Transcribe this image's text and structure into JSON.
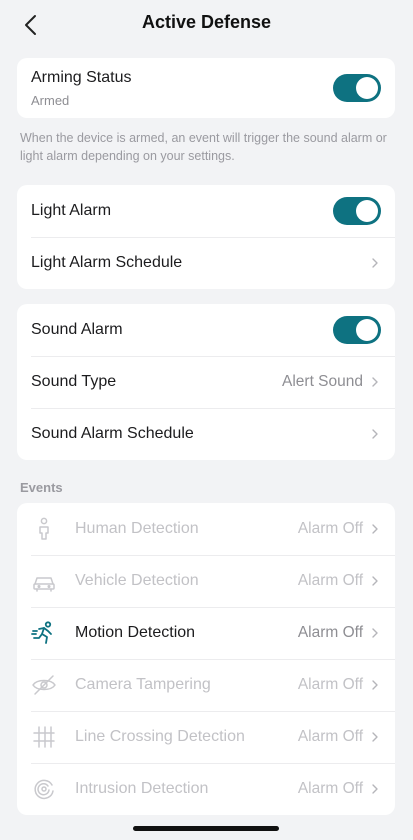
{
  "header": {
    "title": "Active Defense"
  },
  "arming": {
    "title": "Arming Status",
    "status": "Armed",
    "enabled": true,
    "note": "When the device is armed, an event will trigger the sound alarm or light alarm depending on your settings."
  },
  "light": {
    "label": "Light Alarm",
    "enabled": true,
    "schedule_label": "Light Alarm Schedule"
  },
  "sound": {
    "label": "Sound Alarm",
    "enabled": true,
    "type_label": "Sound Type",
    "type_value": "Alert Sound",
    "schedule_label": "Sound Alarm Schedule"
  },
  "events": {
    "section_label": "Events",
    "items": [
      {
        "icon": "human-icon",
        "label": "Human Detection",
        "value": "Alarm Off",
        "active": false
      },
      {
        "icon": "vehicle-icon",
        "label": "Vehicle Detection",
        "value": "Alarm Off",
        "active": false
      },
      {
        "icon": "running-person-icon",
        "label": "Motion Detection",
        "value": "Alarm Off",
        "active": true
      },
      {
        "icon": "eye-slash-icon",
        "label": "Camera Tampering",
        "value": "Alarm Off",
        "active": false
      },
      {
        "icon": "line-crossing-icon",
        "label": "Line Crossing Detection",
        "value": "Alarm Off",
        "active": false
      },
      {
        "icon": "intrusion-icon",
        "label": "Intrusion Detection",
        "value": "Alarm Off",
        "active": false
      }
    ]
  },
  "colors": {
    "accent": "#0e7281",
    "background": "#f2f3f5",
    "card": "#ffffff",
    "secondary_text": "#8e8e93",
    "disabled_text": "#c2c2c6"
  }
}
